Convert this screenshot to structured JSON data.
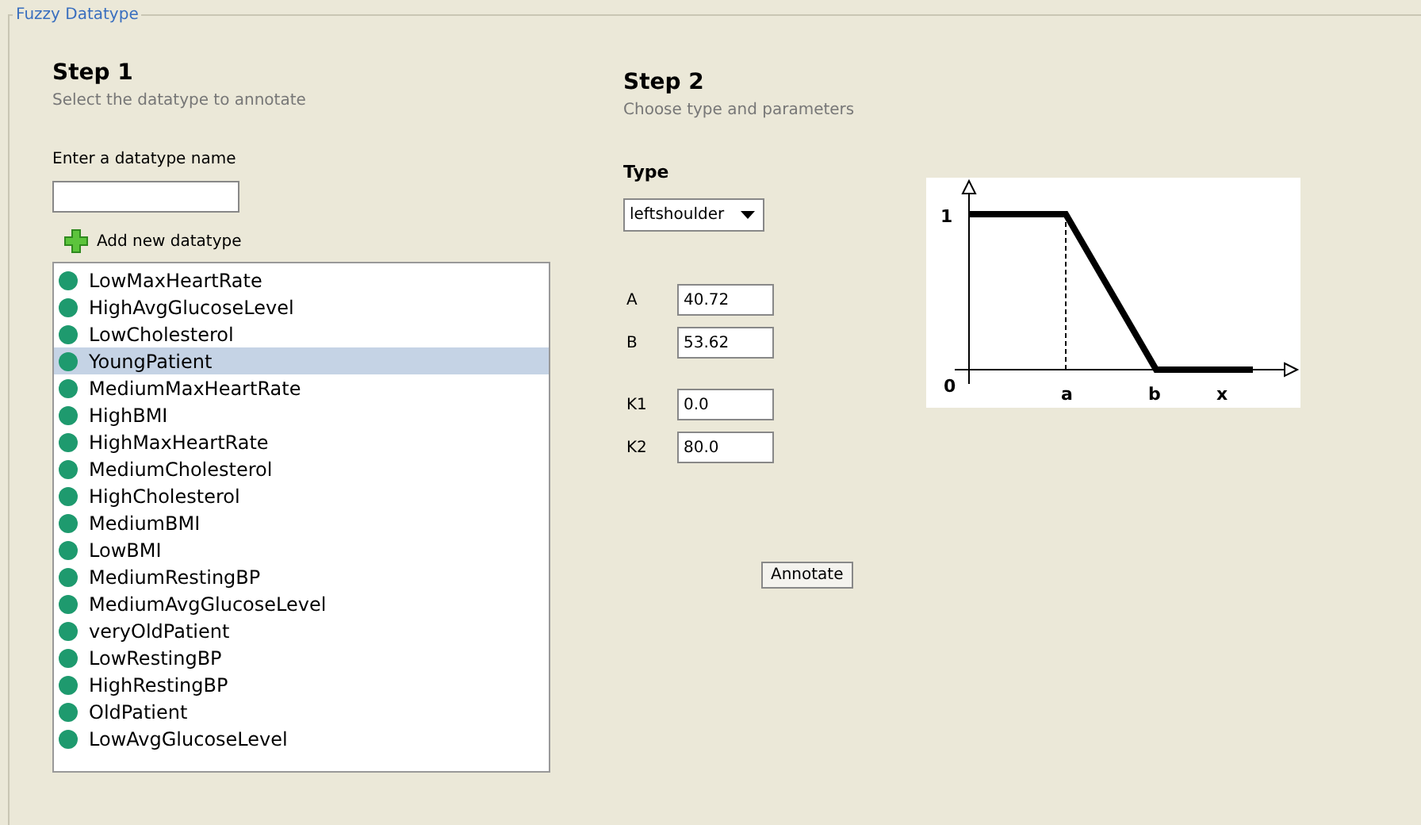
{
  "panel": {
    "legend": "Fuzzy Datatype"
  },
  "step1": {
    "title": "Step 1",
    "subtitle": "Select the datatype to annotate",
    "name_label": "Enter a datatype name",
    "add_button": "Add new datatype",
    "datatypes": [
      {
        "label": "LowMaxHeartRate",
        "selected": false
      },
      {
        "label": "HighAvgGlucoseLevel",
        "selected": false
      },
      {
        "label": "LowCholesterol",
        "selected": false
      },
      {
        "label": "YoungPatient",
        "selected": true
      },
      {
        "label": "MediumMaxHeartRate",
        "selected": false
      },
      {
        "label": "HighBMI",
        "selected": false
      },
      {
        "label": "HighMaxHeartRate",
        "selected": false
      },
      {
        "label": "MediumCholesterol",
        "selected": false
      },
      {
        "label": "HighCholesterol",
        "selected": false
      },
      {
        "label": "MediumBMI",
        "selected": false
      },
      {
        "label": "LowBMI",
        "selected": false
      },
      {
        "label": "MediumRestingBP",
        "selected": false
      },
      {
        "label": "MediumAvgGlucoseLevel",
        "selected": false
      },
      {
        "label": "veryOldPatient",
        "selected": false
      },
      {
        "label": "LowRestingBP",
        "selected": false
      },
      {
        "label": "HighRestingBP",
        "selected": false
      },
      {
        "label": "OldPatient",
        "selected": false
      },
      {
        "label": "LowAvgGlucoseLevel",
        "selected": false
      }
    ]
  },
  "step2": {
    "title": "Step 2",
    "subtitle": "Choose type and parameters",
    "type_label": "Type",
    "type_value": "leftshoulder",
    "param_groups": [
      [
        {
          "label": "A",
          "value": "40.72"
        },
        {
          "label": "B",
          "value": "53.62"
        }
      ],
      [
        {
          "label": "K1",
          "value": "0.0"
        },
        {
          "label": "K2",
          "value": "80.0"
        }
      ]
    ],
    "annotate_button": "Annotate",
    "diagram": {
      "y_label": "1",
      "origin_label": "0",
      "a_label": "a",
      "b_label": "b",
      "x_label": "x"
    }
  }
}
